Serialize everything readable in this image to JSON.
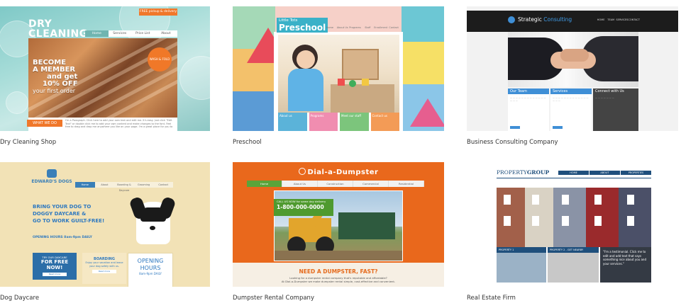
{
  "cards": [
    {
      "caption": "Dry Cleaning Shop",
      "site": {
        "title_line1": "DRY",
        "title_line2": "CLEANING",
        "promo": "FREE pickup & delivery",
        "nav": [
          "Home",
          "Services",
          "Price List",
          "About"
        ],
        "hero_line1": "BECOME",
        "hero_line2": "A MEMBER",
        "hero_line3": "and get",
        "hero_line4": "10% OFF",
        "hero_line5": "your first order",
        "badge": "WASH & FOLD",
        "section": "WHAT WE DO",
        "paragraph": "I'm a Paragraph. Click here to add your own text and edit me. It's easy. Just click \"Edit Text\" or double click me to add your own content and make changes to the font. Feel free to drag and drop me anywhere you like on your page. I'm a great place for you to"
      }
    },
    {
      "caption": "Preschool",
      "site": {
        "title_small": "Little Tots",
        "title": "Preschool",
        "nav": [
          "Home",
          "About Us",
          "Programs",
          "Staff",
          "Enrollment",
          "Contact"
        ],
        "boxes": [
          "About us",
          "Programs",
          "Meet our staff",
          "Contact us"
        ]
      }
    },
    {
      "caption": "Business Consulting Company",
      "site": {
        "brand_a": "Strategic ",
        "brand_b": "Consulting",
        "nav": [
          "HOME",
          "TEAM",
          "SERVICES",
          "CONTACT"
        ],
        "col1": "Our Team",
        "col2": "Services",
        "col3": "Connect with Us"
      }
    },
    {
      "caption": "Dog Daycare",
      "site": {
        "logo": "EDWARD'S DOGS",
        "nav": [
          "Home",
          "About",
          "Boarding & Daycare",
          "Grooming",
          "Contact"
        ],
        "headline_1": "BRING YOUR DOG TO",
        "headline_2": "DOGGY DAYCARE &",
        "headline_3": "GO TO WORK GUILT-FREE!",
        "hours_line": "OPENING HOURS 8am-9pm DAILY",
        "box1_small": "TRY OUR DAYCARE",
        "box1_big": "FOR FREE NOW!",
        "box1_btn": "Read more",
        "box2_title": "BOARDING",
        "box2_text": "Enjoy your vacation and leave your dog safely with us.",
        "box2_btn": "Read more",
        "box3_big": "OPENING HOURS",
        "box3_small": "8am-9pm DAILY"
      }
    },
    {
      "caption": "Dumpster Rental Company",
      "site": {
        "title": "Dial-a-Dumpster",
        "nav": [
          "Home",
          "About Us",
          "Construction",
          "Commercial",
          "Residential"
        ],
        "call_small": "CALL US NOW for same day delivery",
        "phone": "1-800-000-0000",
        "question": "NEED A DUMPSTER, FAST?",
        "subline1": "Looking for a dumpster rental company that's reputable and affordable?",
        "subline2": "At Dial-a-Dumpster we make dumpster rental simple, cost-effective and convenient."
      }
    },
    {
      "caption": "Real Estate Firm",
      "site": {
        "logo_a": "PROPERTY",
        "logo_b": "GROUP",
        "nav": [
          "HOME",
          "ABOUT",
          "PROPERTIES"
        ],
        "tile1": "PROPERTY 1",
        "tile2": "PROPERTY 2 - GET NEARBY",
        "testimonial": "\"I'm a testimonial. Click me to edit and add text that says something nice about you and your services.\""
      }
    }
  ],
  "colors": {
    "teal": "#7fc9c7",
    "orange": "#f0772a",
    "blue": "#3f8fd6",
    "green": "#4f9a2f",
    "navy": "#1f4f7c"
  }
}
